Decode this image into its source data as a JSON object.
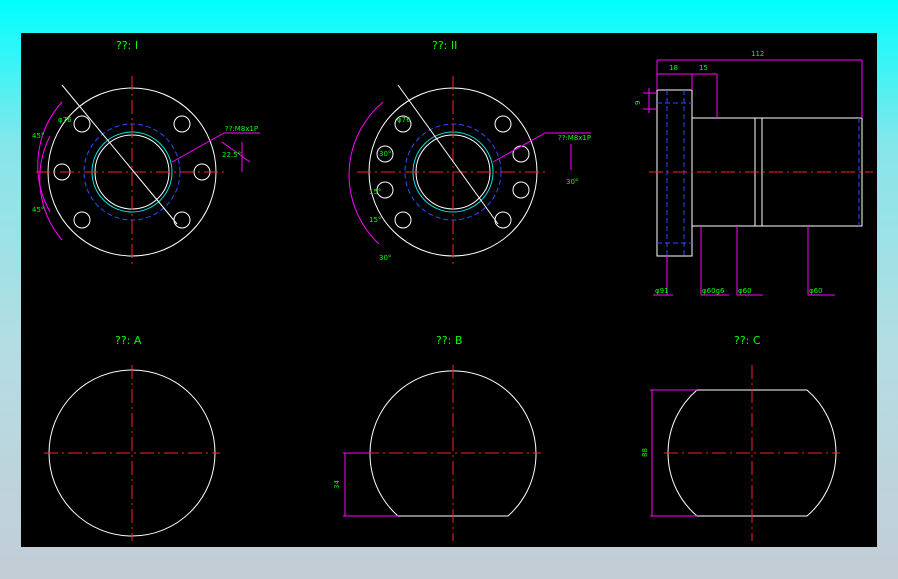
{
  "views": {
    "view_I": "??: I",
    "view_II": "??: II",
    "view_A": "??: A",
    "view_B": "??: B",
    "view_C": "??: C"
  },
  "dims": {
    "i_dia76": "φ76",
    "i_thread": "??:M8x1P",
    "i_angle_a": "45°",
    "i_angle_b": "45°",
    "i_angle_c": "22.5°",
    "ii_dia76": "φ76",
    "ii_thread": "??:M8x1P",
    "ii_a1": "30°",
    "ii_a2": "15°",
    "ii_a3": "15°",
    "ii_a4": "30°",
    "ii_a5": "30°",
    "side_len": "112",
    "side_18": "18",
    "side_15": "15",
    "side_9": "9",
    "side_d91": "φ91",
    "side_d60g6": "φ60g6",
    "side_d60a": "φ60",
    "side_d60b": "φ60",
    "b_34": "34",
    "c_88": "88"
  },
  "colors": {
    "background": "#000000",
    "outline": "#ffffff",
    "centerline": "#ff2020",
    "hidden": "#2a4dff",
    "dimension": "#ff00ff",
    "text": "#00ff00"
  }
}
